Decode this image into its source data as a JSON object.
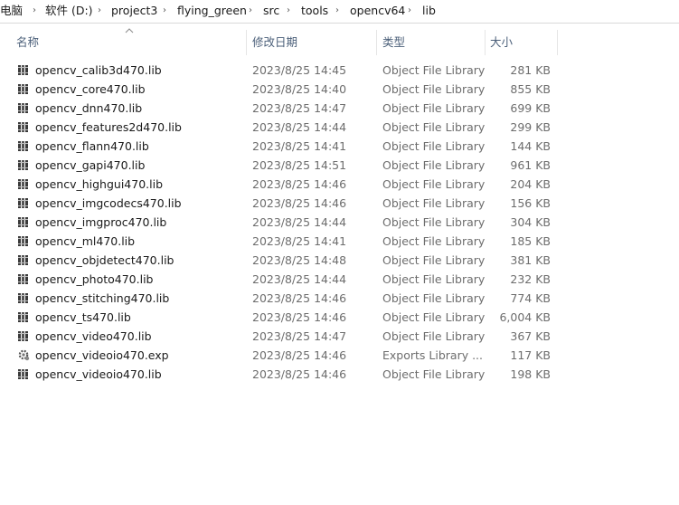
{
  "breadcrumb": {
    "items": [
      "电脑",
      "软件 (D:)",
      "project3",
      "flying_green",
      "src",
      "tools",
      "opencv64",
      "lib"
    ],
    "separator": "›"
  },
  "columns": {
    "name": "名称",
    "date": "修改日期",
    "type": "类型",
    "size": "大小"
  },
  "files": [
    {
      "name": "opencv_calib3d470.lib",
      "date": "2023/8/25 14:45",
      "type": "Object File Library",
      "size": "281 KB",
      "icon": "library-file-icon"
    },
    {
      "name": "opencv_core470.lib",
      "date": "2023/8/25 14:40",
      "type": "Object File Library",
      "size": "855 KB",
      "icon": "library-file-icon"
    },
    {
      "name": "opencv_dnn470.lib",
      "date": "2023/8/25 14:47",
      "type": "Object File Library",
      "size": "699 KB",
      "icon": "library-file-icon"
    },
    {
      "name": "opencv_features2d470.lib",
      "date": "2023/8/25 14:44",
      "type": "Object File Library",
      "size": "299 KB",
      "icon": "library-file-icon"
    },
    {
      "name": "opencv_flann470.lib",
      "date": "2023/8/25 14:41",
      "type": "Object File Library",
      "size": "144 KB",
      "icon": "library-file-icon"
    },
    {
      "name": "opencv_gapi470.lib",
      "date": "2023/8/25 14:51",
      "type": "Object File Library",
      "size": "961 KB",
      "icon": "library-file-icon"
    },
    {
      "name": "opencv_highgui470.lib",
      "date": "2023/8/25 14:46",
      "type": "Object File Library",
      "size": "204 KB",
      "icon": "library-file-icon"
    },
    {
      "name": "opencv_imgcodecs470.lib",
      "date": "2023/8/25 14:46",
      "type": "Object File Library",
      "size": "156 KB",
      "icon": "library-file-icon"
    },
    {
      "name": "opencv_imgproc470.lib",
      "date": "2023/8/25 14:44",
      "type": "Object File Library",
      "size": "304 KB",
      "icon": "library-file-icon"
    },
    {
      "name": "opencv_ml470.lib",
      "date": "2023/8/25 14:41",
      "type": "Object File Library",
      "size": "185 KB",
      "icon": "library-file-icon"
    },
    {
      "name": "opencv_objdetect470.lib",
      "date": "2023/8/25 14:48",
      "type": "Object File Library",
      "size": "381 KB",
      "icon": "library-file-icon"
    },
    {
      "name": "opencv_photo470.lib",
      "date": "2023/8/25 14:44",
      "type": "Object File Library",
      "size": "232 KB",
      "icon": "library-file-icon"
    },
    {
      "name": "opencv_stitching470.lib",
      "date": "2023/8/25 14:46",
      "type": "Object File Library",
      "size": "774 KB",
      "icon": "library-file-icon"
    },
    {
      "name": "opencv_ts470.lib",
      "date": "2023/8/25 14:46",
      "type": "Object File Library",
      "size": "6,004 KB",
      "icon": "library-file-icon"
    },
    {
      "name": "opencv_video470.lib",
      "date": "2023/8/25 14:47",
      "type": "Object File Library",
      "size": "367 KB",
      "icon": "library-file-icon"
    },
    {
      "name": "opencv_videoio470.exp",
      "date": "2023/8/25 14:46",
      "type": "Exports Library ...",
      "size": "117 KB",
      "icon": "exports-file-icon"
    },
    {
      "name": "opencv_videoio470.lib",
      "date": "2023/8/25 14:46",
      "type": "Object File Library",
      "size": "198 KB",
      "icon": "library-file-icon"
    }
  ]
}
